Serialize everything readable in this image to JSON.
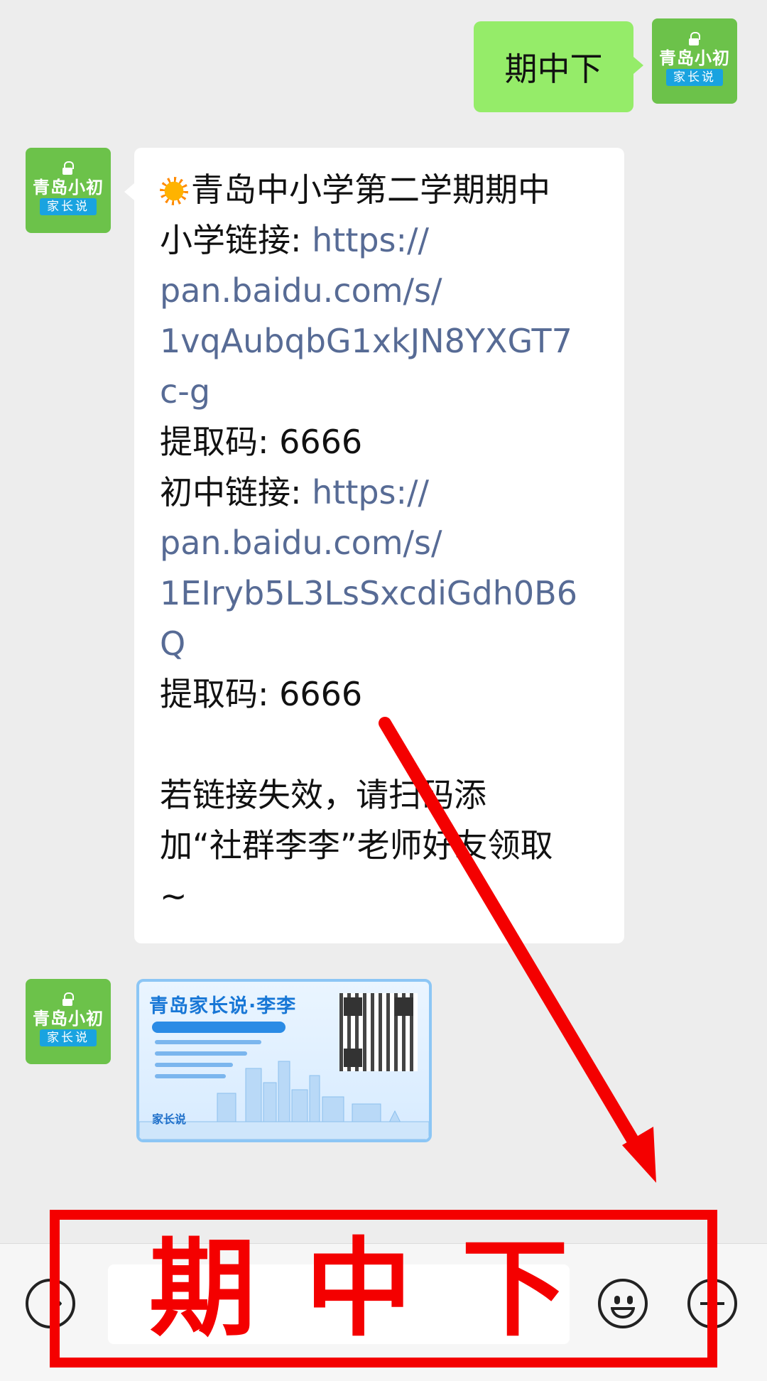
{
  "avatar": {
    "brand": "青岛小初",
    "sub": "家长说"
  },
  "sent_message": {
    "text": "期中下"
  },
  "reply_message": {
    "line1": "青岛中小学第二学期期中",
    "primary_label": "小学链接: ",
    "primary_link_1": "https://",
    "primary_link_2": "pan.baidu.com/s/",
    "primary_link_3": "1vqAubqbG1xkJN8YXGT7",
    "primary_link_4": "c-g",
    "primary_code": "提取码: 6666",
    "middle_label": "初中链接: ",
    "middle_link_1": "https://",
    "middle_link_2": "pan.baidu.com/s/",
    "middle_link_3": "1EIryb5L3LsSxcdiGdh0B6",
    "middle_link_4": "Q",
    "middle_code": "提取码: 6666",
    "footer_1": "若链接失效，请扫码添",
    "footer_2": "加“社群李李”老师好友领取",
    "footer_3": "~"
  },
  "card": {
    "title": "青岛家长说·李李",
    "logo": "家长说"
  },
  "overlay_text": "期中下",
  "colors": {
    "accent_red": "#f40000",
    "bubble_green": "#95ec69",
    "link_blue": "#576b95",
    "avatar_green": "#6cc24a"
  },
  "icons": [
    "voice-icon",
    "emoji-icon",
    "plus-icon",
    "sun-emoji"
  ]
}
